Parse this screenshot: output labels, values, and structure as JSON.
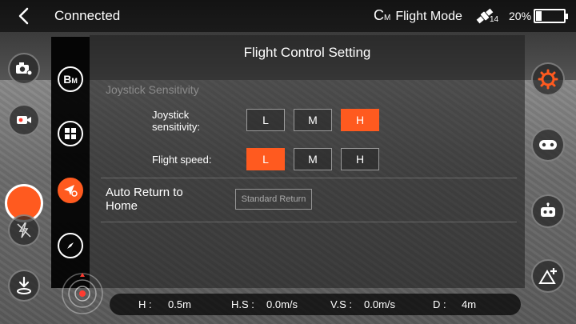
{
  "header": {
    "status": "Connected",
    "mode_logo_main": "C",
    "mode_logo_sub": "M",
    "flight_mode": "Flight Mode",
    "satellite_count": "14",
    "battery_percent_text": "20%",
    "battery_level": 0.2
  },
  "left_toolbar": {
    "buttons": [
      "camera-settings-icon",
      "video-mode-icon",
      "shutter-button",
      "flash-off-icon",
      "landing-icon"
    ]
  },
  "right_toolbar": {
    "buttons": [
      "settings-gear-icon",
      "gamepad-icon",
      "robot-icon",
      "waypoint-add-icon"
    ],
    "accent": "#ff5a1f"
  },
  "side_nav": {
    "bm_main": "B",
    "bm_sub": "M",
    "items": [
      "basic-mode-icon",
      "grid-icon",
      "flight-control-icon",
      "compass-icon"
    ],
    "active": "flight-control-icon"
  },
  "panel": {
    "title": "Flight Control Setting",
    "section_hint": "Joystick Sensitivity",
    "joystick_label_line1": "Joystick",
    "joystick_label_line2": "sensitivity:",
    "joystick_options": [
      "L",
      "M",
      "H"
    ],
    "joystick_selected": "H",
    "speed_label": "Flight speed:",
    "speed_options": [
      "L",
      "M",
      "H"
    ],
    "speed_selected": "L",
    "auto_return_line1": "Auto Return to",
    "auto_return_line2": "Home",
    "auto_return_button": "Standard Return"
  },
  "telemetry": {
    "h_label": "H :",
    "h_value": "0.5m",
    "hs_label": "H.S :",
    "hs_value": "0.0m/s",
    "vs_label": "V.S :",
    "vs_value": "0.0m/s",
    "d_label": "D :",
    "d_value": "4m"
  }
}
